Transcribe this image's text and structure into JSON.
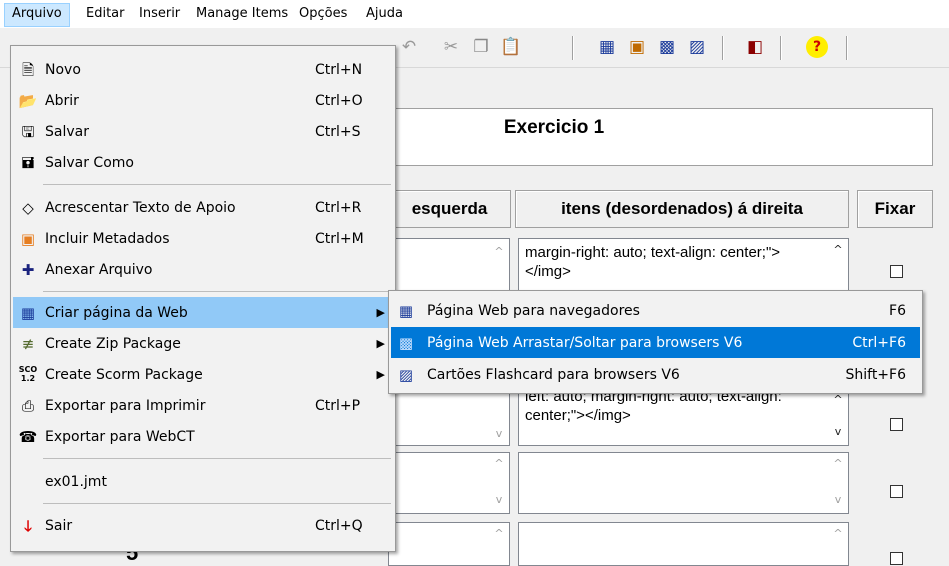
{
  "menubar": {
    "items": [
      "Arquivo",
      "Editar",
      "Inserir",
      "Manage Items",
      "Opções",
      "Ajuda"
    ]
  },
  "toolbar": {
    "icons": [
      "undo-icon",
      "cut-icon",
      "copy-icon",
      "paste-icon",
      "web-page-icon",
      "save-web-icon",
      "web-dragdrop-icon",
      "flashcard-icon",
      "color-icon",
      "help-icon"
    ]
  },
  "form": {
    "title": "Exercicio 1",
    "headers": {
      "left": "esquerda",
      "right": "itens (desordenados) á direita",
      "fix": "Fixar"
    },
    "right_cells": [
      "margin-right: auto; text-align: center;\"></img>",
      "left: auto; margin-right: auto; text-align: center;\"></img>",
      "",
      ""
    ],
    "row_number_visible": "5"
  },
  "file_menu": {
    "items": [
      {
        "label": "Novo",
        "shortcut": "Ctrl+N",
        "icon": "new-file-icon"
      },
      {
        "label": "Abrir",
        "shortcut": "Ctrl+O",
        "icon": "open-folder-icon"
      },
      {
        "label": "Salvar",
        "shortcut": "Ctrl+S",
        "icon": "save-icon"
      },
      {
        "label": "Salvar Como",
        "shortcut": "",
        "icon": "save-as-icon"
      },
      {
        "label": "Acrescentar Texto de Apoio",
        "shortcut": "Ctrl+R",
        "icon": "text-support-icon"
      },
      {
        "label": "Incluir Metadados",
        "shortcut": "Ctrl+M",
        "icon": "metadata-icon"
      },
      {
        "label": "Anexar Arquivo",
        "shortcut": "",
        "icon": "attach-icon"
      },
      {
        "label": "Criar página da Web",
        "shortcut": "",
        "icon": "web-page-icon"
      },
      {
        "label": "Create Zip Package",
        "shortcut": "",
        "icon": "zip-icon"
      },
      {
        "label": "Create Scorm Package",
        "shortcut": "",
        "icon": "scorm-icon"
      },
      {
        "label": "Exportar para Imprimir",
        "shortcut": "Ctrl+P",
        "icon": "printer-icon"
      },
      {
        "label": "Exportar para WebCT",
        "shortcut": "",
        "icon": "webct-icon"
      },
      {
        "label": "ex01.jmt",
        "shortcut": ""
      },
      {
        "label": "Sair",
        "shortcut": "Ctrl+Q",
        "icon": "exit-arrow-icon"
      }
    ],
    "scorm_badge": "SCO 1.2"
  },
  "web_submenu": {
    "items": [
      {
        "label": "Página Web para navegadores",
        "shortcut": "F6"
      },
      {
        "label": "Página Web Arrastar/Soltar para browsers V6",
        "shortcut": "Ctrl+F6"
      },
      {
        "label": "Cartões Flashcard para browsers V6",
        "shortcut": "Shift+F6"
      }
    ]
  },
  "colors": {
    "menu_highlight": "#91c9f7",
    "submenu_highlight": "#0078d7",
    "menubar_active": "#cce8ff"
  }
}
